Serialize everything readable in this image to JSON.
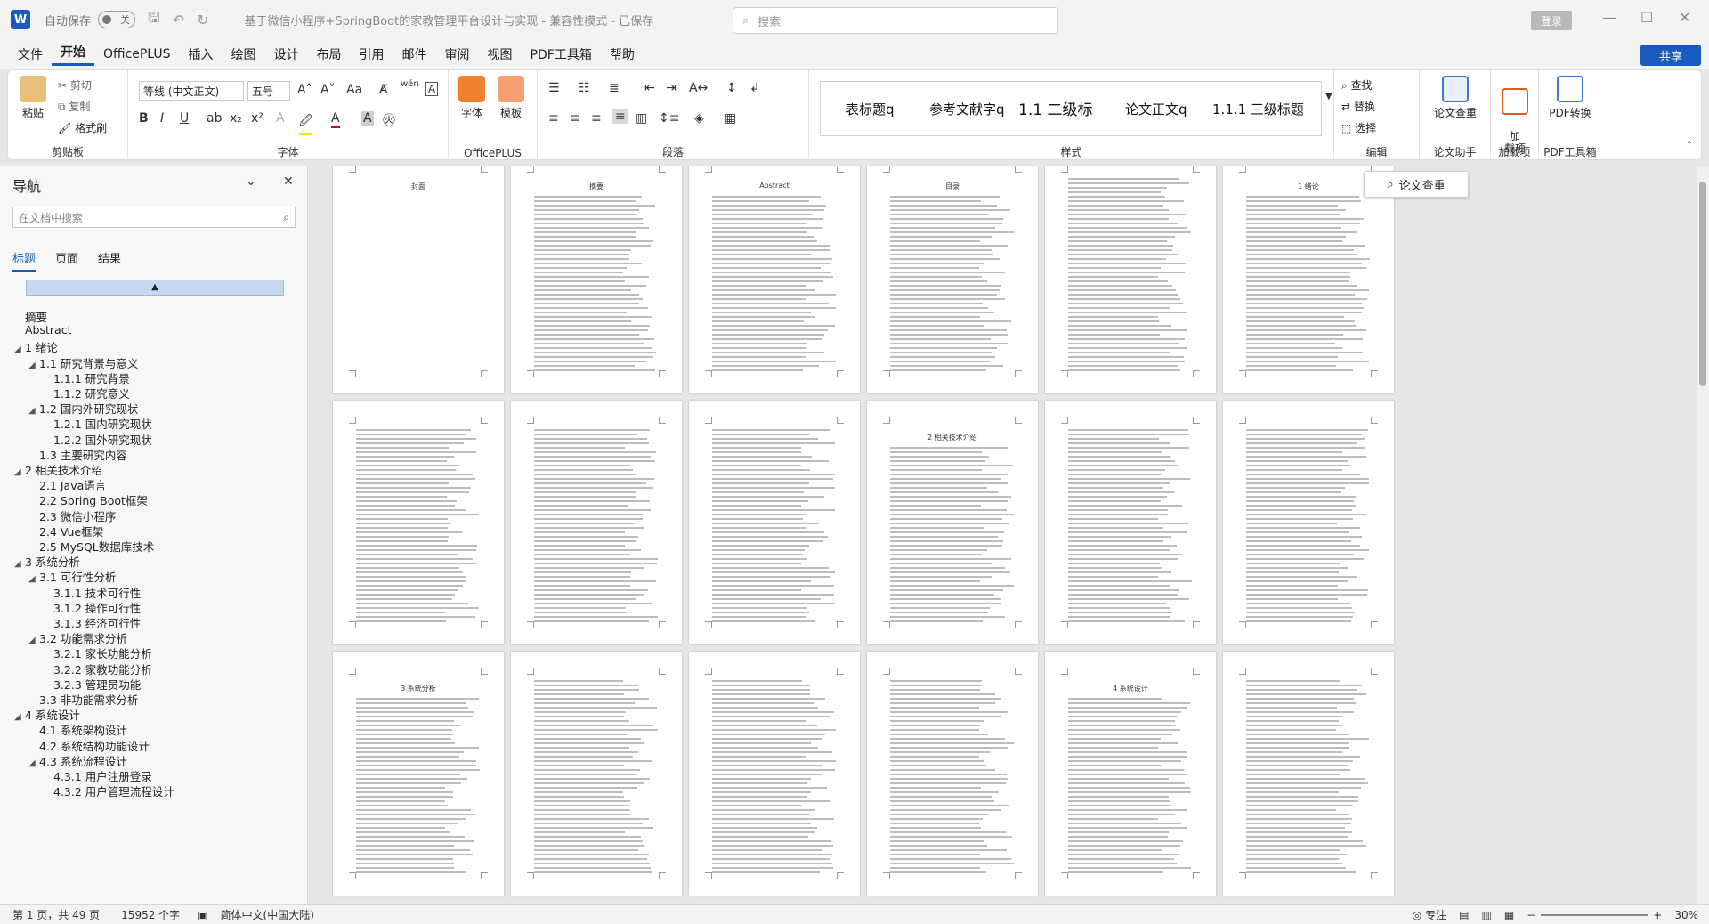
{
  "titlebar": {
    "app_icon": "W",
    "autosave_label": "自动保存",
    "autosave_state": "关",
    "doc_title": "基于微信小程序+SpringBoot的家教管理平台设计与实现  -  兼容性模式  -  已保存",
    "search_placeholder": "搜索",
    "login": "登录"
  },
  "menu": [
    "文件",
    "开始",
    "OfficePLUS",
    "插入",
    "绘图",
    "设计",
    "布局",
    "引用",
    "邮件",
    "审阅",
    "视图",
    "PDF工具箱",
    "帮助"
  ],
  "share": "共享",
  "ribbon": {
    "clipboard": {
      "paste": "粘贴",
      "cut": "剪切",
      "copy": "复制",
      "format_painter": "格式刷",
      "label": "剪贴板"
    },
    "font": {
      "font_name": "等线 (中文正文)",
      "font_size": "五号",
      "label": "字体",
      "buttons": [
        "B",
        "I",
        "U",
        "ab",
        "x₂",
        "x²",
        "A",
        "A",
        "A"
      ]
    },
    "officeplus": {
      "font": "字体",
      "template": "模板",
      "label": "OfficePLUS"
    },
    "paragraph": {
      "label": "段落"
    },
    "styles": {
      "items": [
        "表标题q",
        "参考文献字q",
        "1.1  二级标",
        "论文正文q",
        "1.1.1  三级标题"
      ],
      "label": "样式"
    },
    "editing": {
      "find": "查找",
      "replace": "替换",
      "select": "选择",
      "label": "编辑"
    },
    "paper_check": {
      "btn": "论文查重",
      "label": "论文助手"
    },
    "addin": {
      "btn": "加\n载项",
      "label": "加载项"
    },
    "pdf": {
      "btn": "PDF转换",
      "label": "PDF工具箱"
    }
  },
  "nav": {
    "title": "导航",
    "search_placeholder": "在文档中搜索",
    "tabs": [
      "标题",
      "页面",
      "结果"
    ],
    "items": [
      {
        "t": "摘要",
        "lvl": 0,
        "arrow": ""
      },
      {
        "t": "Abstract",
        "lvl": 0,
        "arrow": ""
      },
      {
        "t": "1 绪论",
        "lvl": 0,
        "arrow": "◢"
      },
      {
        "t": "1.1 研究背景与意义",
        "lvl": 1,
        "arrow": "◢"
      },
      {
        "t": "1.1.1 研究背景",
        "lvl": 2,
        "arrow": ""
      },
      {
        "t": "1.1.2 研究意义",
        "lvl": 2,
        "arrow": ""
      },
      {
        "t": "1.2 国内外研究现状",
        "lvl": 1,
        "arrow": "◢"
      },
      {
        "t": "1.2.1 国内研究现状",
        "lvl": 2,
        "arrow": ""
      },
      {
        "t": "1.2.2 国外研究现状",
        "lvl": 2,
        "arrow": ""
      },
      {
        "t": "1.3 主要研究内容",
        "lvl": 1,
        "arrow": ""
      },
      {
        "t": "2 相关技术介绍",
        "lvl": 0,
        "arrow": "◢"
      },
      {
        "t": "2.1 Java语言",
        "lvl": 1,
        "arrow": ""
      },
      {
        "t": "2.2  Spring Boot框架",
        "lvl": 1,
        "arrow": ""
      },
      {
        "t": "2.3 微信小程序",
        "lvl": 1,
        "arrow": ""
      },
      {
        "t": "2.4  Vue框架",
        "lvl": 1,
        "arrow": ""
      },
      {
        "t": "2.5  MySQL数据库技术",
        "lvl": 1,
        "arrow": ""
      },
      {
        "t": "3 系统分析",
        "lvl": 0,
        "arrow": "◢"
      },
      {
        "t": "3.1 可行性分析",
        "lvl": 1,
        "arrow": "◢"
      },
      {
        "t": "3.1.1 技术可行性",
        "lvl": 2,
        "arrow": ""
      },
      {
        "t": "3.1.2 操作可行性",
        "lvl": 2,
        "arrow": ""
      },
      {
        "t": "3.1.3 经济可行性",
        "lvl": 2,
        "arrow": ""
      },
      {
        "t": "3.2 功能需求分析",
        "lvl": 1,
        "arrow": "◢"
      },
      {
        "t": "3.2.1 家长功能分析",
        "lvl": 2,
        "arrow": ""
      },
      {
        "t": "3.2.2 家教功能分析",
        "lvl": 2,
        "arrow": ""
      },
      {
        "t": "3.2.3 管理员功能",
        "lvl": 2,
        "arrow": ""
      },
      {
        "t": "3.3 非功能需求分析",
        "lvl": 1,
        "arrow": ""
      },
      {
        "t": "4 系统设计",
        "lvl": 0,
        "arrow": "◢"
      },
      {
        "t": "4.1 系统架构设计",
        "lvl": 1,
        "arrow": ""
      },
      {
        "t": "4.2 系统结构功能设计",
        "lvl": 1,
        "arrow": ""
      },
      {
        "t": "4.3 系统流程设计",
        "lvl": 1,
        "arrow": "◢"
      },
      {
        "t": "4.3.1 用户注册登录",
        "lvl": 2,
        "arrow": ""
      },
      {
        "t": "4.3.2 用户管理流程设计",
        "lvl": 2,
        "arrow": ""
      }
    ]
  },
  "pages": [
    {
      "title": "封面"
    },
    {
      "title": "摘要"
    },
    {
      "title": "Abstract"
    },
    {
      "title": "目录"
    },
    {
      "title": ""
    },
    {
      "title": "1 绪论"
    },
    {
      "title": ""
    },
    {
      "title": ""
    },
    {
      "title": ""
    },
    {
      "title": "2 相关技术介绍"
    },
    {
      "title": ""
    },
    {
      "title": ""
    },
    {
      "title": "3 系统分析"
    },
    {
      "title": ""
    },
    {
      "title": ""
    },
    {
      "title": ""
    },
    {
      "title": "4 系统设计"
    },
    {
      "title": ""
    }
  ],
  "float_btn": "论文查重",
  "status": {
    "page": "第 1 页，共 49 页",
    "words": "15952 个字",
    "lang": "简体中文(中国大陆)",
    "focus": "专注",
    "zoom": "30%"
  }
}
